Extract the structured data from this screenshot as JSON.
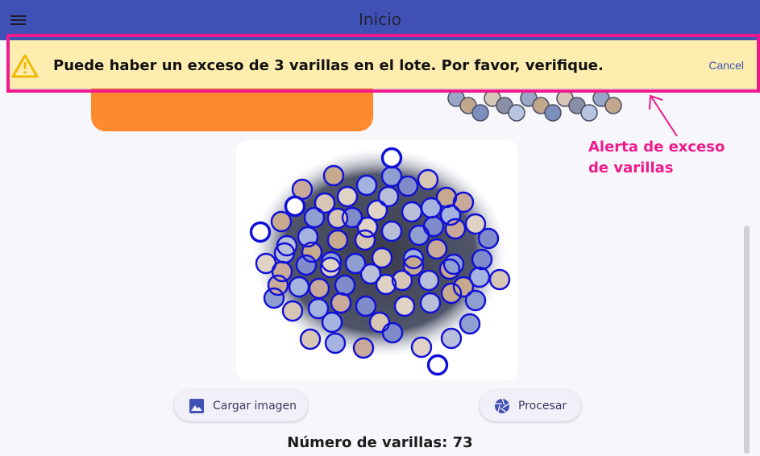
{
  "app_bar": {
    "title": "Inicio",
    "menu_icon": "hamburger-menu-icon",
    "background_color": "#3f51b5"
  },
  "banner": {
    "icon": "warning-icon",
    "message": "Puede haber un exceso de 3 varillas en el lote. Por favor, verifique.",
    "cancel_label": "Cancel",
    "background_color": "#fdeeb0",
    "highlight_color": "#f0198b"
  },
  "annotation": {
    "line1": "Alerta de exceso",
    "line2": "de varillas",
    "color": "#ee1a8a"
  },
  "actions": {
    "load_image_label": "Cargar imagen",
    "load_image_icon": "image-icon",
    "process_label": "Procesar",
    "process_icon": "camera-shutter-icon"
  },
  "result": {
    "count_label": "Número de varillas:",
    "count_value": "73"
  }
}
